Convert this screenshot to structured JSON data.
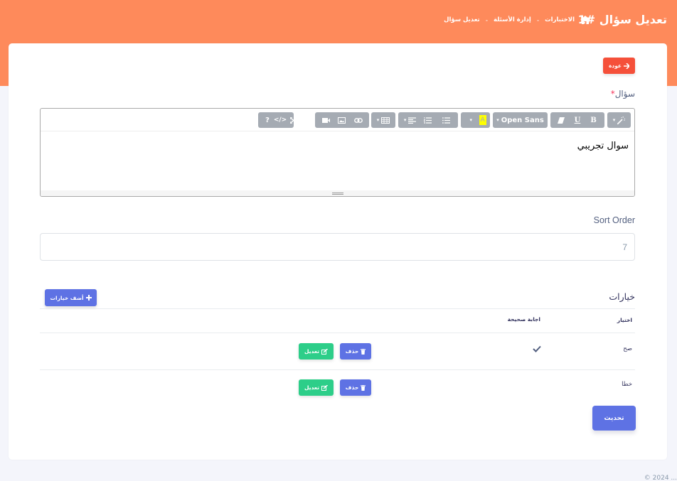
{
  "header": {
    "title": "تعديل سؤال #1",
    "breadcrumb": [
      "الاختبارات",
      "إدارة الأسئلة",
      "تعديل سؤال"
    ]
  },
  "form": {
    "back_label": "عودة",
    "question_label": "سؤال",
    "required_mark": "*",
    "question_text": "سوال تجريبي",
    "editor_font": "Open Sans",
    "sort_label": "Sort Order",
    "sort_value": "7"
  },
  "choices": {
    "title": "خيارات",
    "add_label": "أضف خيارات",
    "columns": [
      "اختيار",
      "اجابة صحيحة"
    ],
    "rows": [
      {
        "choice": "صح",
        "correct": true
      },
      {
        "choice": "خطا",
        "correct": false
      }
    ],
    "delete_label": "حذف",
    "edit_label": "تعديل"
  },
  "update_label": "تحديث",
  "footer_text": "© 2024 ..."
}
